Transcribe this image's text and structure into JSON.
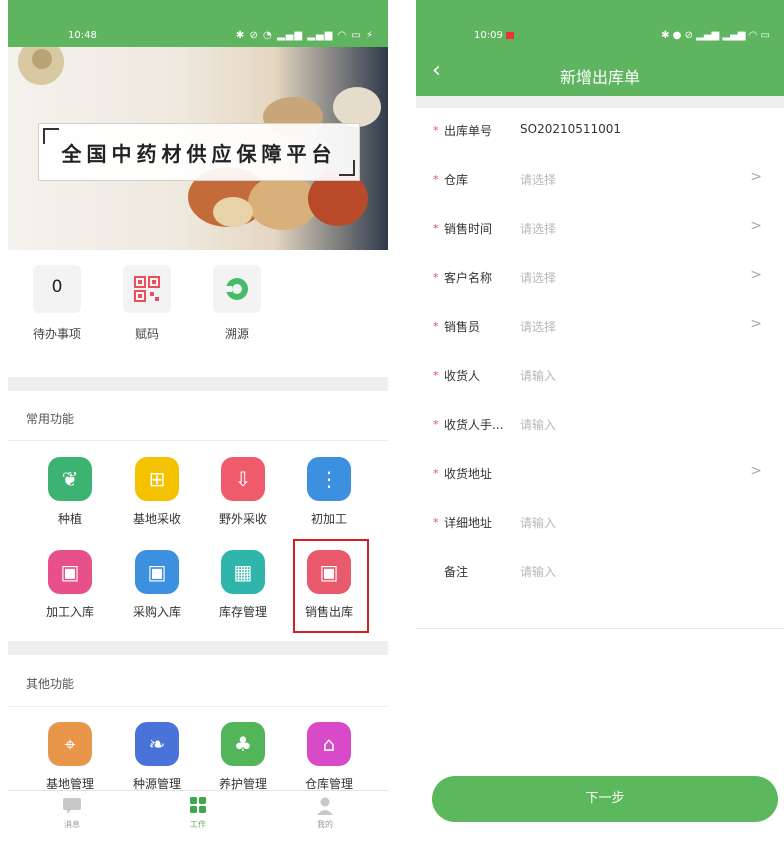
{
  "left": {
    "statusbar": {
      "time": "10:48",
      "icons": "✱ ⊘ ◔ ▂▄▆ ▂▄▆ ◠ ▭ ⚡"
    },
    "banner": {
      "title": "全国中药材供应保障平台"
    },
    "quick": [
      {
        "label": "待办事项",
        "count": "0",
        "icon": "todo-icon"
      },
      {
        "label": "赋码",
        "icon": "qr-code-icon"
      },
      {
        "label": "溯源",
        "icon": "trace-icon"
      }
    ],
    "common": {
      "title": "常用功能",
      "items": [
        {
          "label": "种植",
          "icon": "sprout-icon",
          "color": "#3cb371"
        },
        {
          "label": "基地采收",
          "icon": "basket-icon",
          "color": "#f5c200"
        },
        {
          "label": "野外采收",
          "icon": "harvest-icon",
          "color": "#ef5b6b"
        },
        {
          "label": "初加工",
          "icon": "process-icon",
          "color": "#3d8fe0"
        },
        {
          "label": "加工入库",
          "icon": "inbox-in-icon",
          "color": "#e8508a"
        },
        {
          "label": "采购入库",
          "icon": "purchase-inbox-icon",
          "color": "#3d8fe0"
        },
        {
          "label": "库存管理",
          "icon": "inventory-icon",
          "color": "#30b5ac"
        },
        {
          "label": "销售出库",
          "icon": "sales-outbound-icon",
          "color": "#e85a6c"
        }
      ]
    },
    "other": {
      "title": "其他功能",
      "items": [
        {
          "label": "基地管理",
          "icon": "location-icon",
          "color": "#e8964a"
        },
        {
          "label": "种源管理",
          "icon": "seed-icon",
          "color": "#4a73d9"
        },
        {
          "label": "养护管理",
          "icon": "care-icon",
          "color": "#52b55a"
        },
        {
          "label": "仓库管理",
          "icon": "warehouse-icon",
          "color": "#d94ac8"
        }
      ]
    },
    "tabbar": [
      {
        "label": "消息",
        "icon": "message-icon"
      },
      {
        "label": "工作",
        "icon": "work-grid-icon",
        "active": true
      },
      {
        "label": "我的",
        "icon": "user-icon"
      }
    ]
  },
  "right": {
    "statusbar": {
      "time": "10:09",
      "icons": "✱ ● ⊘ ▂▄▆ ▂▄▆ ◠ ▭"
    },
    "header": {
      "back": "‹",
      "title": "新增出库单"
    },
    "form": [
      {
        "label": "出库单号",
        "required": true,
        "value": "SO20210511001",
        "placeholder": "",
        "arrow": false
      },
      {
        "label": "仓库",
        "required": true,
        "value": "",
        "placeholder": "请选择",
        "arrow": true
      },
      {
        "label": "销售时间",
        "required": true,
        "value": "",
        "placeholder": "请选择",
        "arrow": true
      },
      {
        "label": "客户名称",
        "required": true,
        "value": "",
        "placeholder": "请选择",
        "arrow": true
      },
      {
        "label": "销售员",
        "required": true,
        "value": "",
        "placeholder": "请选择",
        "arrow": true
      },
      {
        "label": "收货人",
        "required": true,
        "value": "",
        "placeholder": "请输入",
        "arrow": false
      },
      {
        "label": "收货人手...",
        "required": true,
        "value": "",
        "placeholder": "请输入",
        "arrow": false
      },
      {
        "label": "收货地址",
        "required": true,
        "value": "",
        "placeholder": "",
        "arrow": true
      },
      {
        "label": "详细地址",
        "required": true,
        "value": "",
        "placeholder": "请输入",
        "arrow": false
      },
      {
        "label": "备注",
        "required": false,
        "value": "",
        "placeholder": "请输入",
        "arrow": false
      }
    ],
    "required_mark": "*",
    "arrow_glyph": ">",
    "next_button": "下一步"
  },
  "colors": {
    "brand_green": "#5fb55f",
    "highlight_red": "#d62020"
  }
}
